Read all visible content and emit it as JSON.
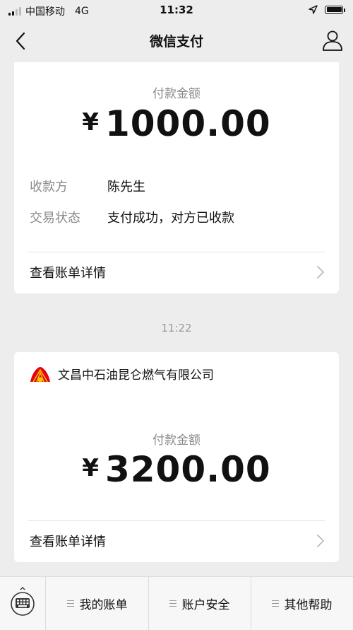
{
  "status_bar": {
    "carrier": "中国移动",
    "network": "4G",
    "time": "11:32"
  },
  "nav": {
    "title": "微信支付",
    "back_icon": "back-arrow-icon",
    "profile_icon": "person-icon"
  },
  "payment1": {
    "amount_label": "付款金额",
    "currency": "¥",
    "amount": "1000.00",
    "payee_label": "收款方",
    "payee": "陈先生",
    "status_label": "交易状态",
    "status": "支付成功，对方已收款",
    "detail_label": "查看账单详情"
  },
  "timestamp": "11:22",
  "payment2": {
    "merchant": "文昌中石油昆仑燃气有限公司",
    "amount_label": "付款金额",
    "currency": "¥",
    "amount": "3200.00",
    "detail_label": "查看账单详情"
  },
  "bottom_menu": {
    "items": [
      {
        "label": "我的账单"
      },
      {
        "label": "账户安全"
      },
      {
        "label": "其他帮助"
      }
    ]
  },
  "colors": {
    "background": "#ededed",
    "card": "#ffffff",
    "muted_text": "#8a8a8a",
    "logo_red": "#e60012",
    "logo_yellow": "#f7c600"
  }
}
